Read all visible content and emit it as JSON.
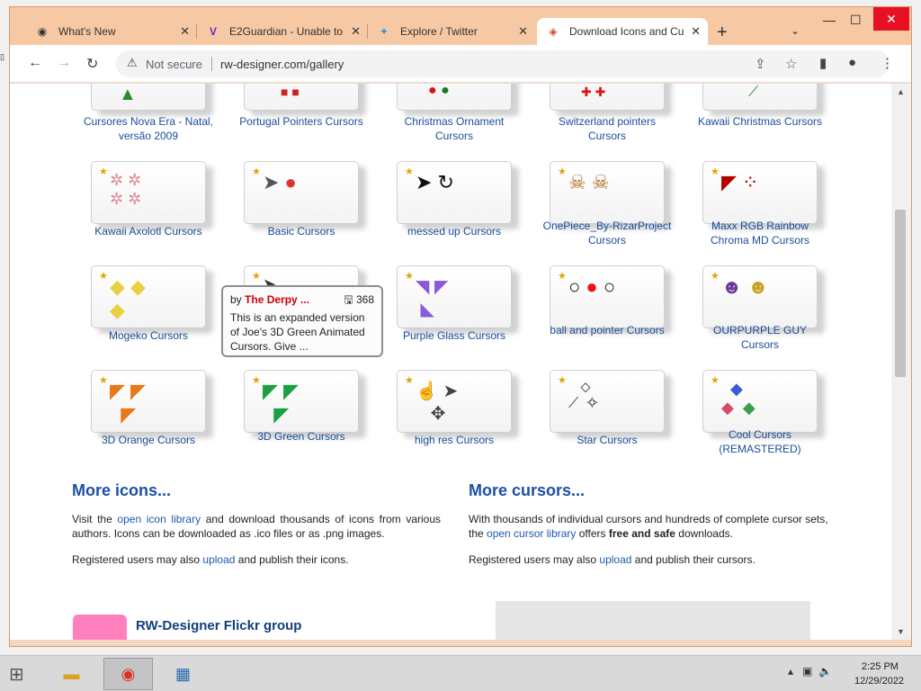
{
  "browser": {
    "tabs": [
      {
        "title": "What's New",
        "icon": "chrome-icon"
      },
      {
        "title": "E2Guardian - Unable to",
        "icon": "e2guardian-icon"
      },
      {
        "title": "Explore / Twitter",
        "icon": "twitter-icon"
      },
      {
        "title": "Download Icons and Cu",
        "icon": "rw-designer-icon",
        "active": true
      }
    ],
    "security_label": "Not secure",
    "url": "rw-designer.com/gallery"
  },
  "gallery": {
    "row0": [
      "Cursores Nova Era - Natal, versão 2009",
      "Portugal Pointers Cursors",
      "Christmas Ornament Cursors",
      "Switzerland pointers Cursors",
      "Kawaii Christmas Cursors"
    ],
    "row1": [
      "Kawaii Axolotl Cursors",
      "Basic Cursors",
      "messed up Cursors",
      "OnePiece_By-RizarProject Cursors",
      "Maxx RGB Rainbow Chroma MD Cursors"
    ],
    "row2": [
      "Mogeko Cursors",
      "",
      "Purple Glass Cursors",
      "ball and pointer Cursors",
      "OURPURPLE GUY Cursors"
    ],
    "row3": [
      "3D Orange Cursors",
      "3D Green Cursors",
      "high res Cursors",
      "Star Cursors",
      "Cool Cursors (REMASTERED)"
    ]
  },
  "tooltip": {
    "by": "by",
    "author": "The Derpy ...",
    "count": "368",
    "description": "This is an expanded version of Joe's 3D Green Animated Cursors. Give ..."
  },
  "icons_section": {
    "title": "More icons...",
    "p1_pre": "Visit the",
    "p1_link": "open icon library",
    "p1_post": "and download thousands of icons from various authors. Icons can be downloaded as .ico files or as .png images.",
    "p2_pre": "Registered users may also",
    "p2_link": "upload",
    "p2_post": "and publish their icons."
  },
  "cursors_section": {
    "title": "More cursors...",
    "p1_a": "With thousands of individual cursors and hundreds of complete cursor sets, the",
    "p1_link": "open cursor library",
    "p1_b": "offers",
    "p1_bold": "free and safe",
    "p1_c": "downloads.",
    "p2_pre": "Registered users may also",
    "p2_link": "upload",
    "p2_post": "and publish their cursors."
  },
  "flickr": {
    "title": "RW-Designer Flickr group"
  },
  "taskbar": {
    "time": "2:25 PM",
    "date": "12/29/2022"
  }
}
